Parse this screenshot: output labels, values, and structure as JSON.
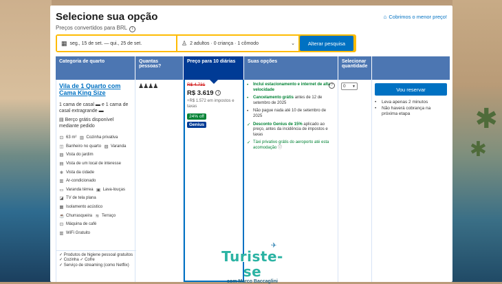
{
  "header": {
    "title": "Selecione sua opção",
    "subtitle": "Preços convertidos para BRL",
    "price_match": "Cobrimos o menor preço!"
  },
  "search": {
    "dates": "seg., 15 de set. — qui., 25 de set.",
    "guests": "2 adultos · 0 criança · 1 cômodo",
    "button": "Alterar pesquisa"
  },
  "table": {
    "headers": {
      "room": "Categoria de quarto",
      "guests": "Quantas pessoas?",
      "price": "Preço para 10 diárias",
      "options": "Suas opções",
      "qty": "Selecionar quantidade"
    },
    "room": {
      "name": "Vila de 1 Quarto com Cama King Size",
      "beds": "1 cama de casal ▬ e 1 cama de casal extragrande ▬",
      "crib": "Berço grátis disponível mediante pedido",
      "facilities": [
        [
          "63 m²",
          "Cozinha privativa"
        ],
        [
          "Banheiro no quarto",
          "Varanda"
        ],
        [
          "Vista do jardim"
        ],
        [
          "Vista de um local de interesse"
        ],
        [
          "Vista da cidade"
        ],
        [
          "Ar-condicionado"
        ],
        [
          "Varanda térrea",
          "Lava-louças"
        ],
        [
          "TV de tela plana"
        ],
        [
          "Isolamento acústico"
        ],
        [
          "Churrasqueira",
          "Terraço"
        ],
        [
          "Máquina de café"
        ],
        [
          "WiFi Gratuito"
        ]
      ],
      "extras": [
        "✓ Produtos de higiene pessoal gratuitos",
        "✓ Cozinha  ✓ Cofre",
        "✓ Serviço de streaming (como Netflix)"
      ]
    },
    "price": {
      "old": "R$ 4.731",
      "current": "R$ 3.619",
      "taxes": "+R$ 1.572 em impostos e taxas",
      "discount": "24% off",
      "genius": "Genius"
    },
    "options": [
      {
        "bold": "Inclui estacionamento e internet de alta velocidade",
        "rest": ""
      },
      {
        "bold": "Cancelamento grátis",
        "rest": " antes de 12 de setembro de 2025"
      },
      {
        "bold": "",
        "rest": "Não pague nada até 10 de setembro de 2025"
      },
      {
        "bold": "Desconto Genius de 15%",
        "rest": " aplicado ao preço, antes da incidência de impostos e taxas"
      },
      {
        "bold": "",
        "rest": "Táxi privativo grátis do aeroporto até esta acomodação"
      }
    ],
    "qty_value": "0",
    "reserve_button": "Vou reservar",
    "notes": [
      "Leva apenas 2 minutos",
      "Não haverá cobrança na próxima etapa"
    ]
  },
  "watermark": {
    "brand": "Turiste-se",
    "byline": "com Marco Baccaglini"
  },
  "colors": {
    "accent": "#0071c2",
    "header_bg": "#4c76b2",
    "selected_header": "#003b95",
    "search_border": "#febb02",
    "green": "#008234"
  }
}
